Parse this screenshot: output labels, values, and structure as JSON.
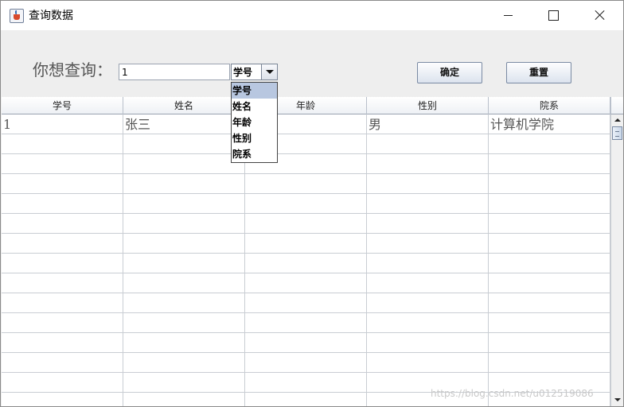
{
  "window": {
    "title": "查询数据"
  },
  "query": {
    "label": "你想查询：",
    "input_value": "1",
    "field_selected": "学号",
    "field_options": [
      "学号",
      "姓名",
      "年龄",
      "性别",
      "院系"
    ],
    "confirm_label": "确定",
    "reset_label": "重置"
  },
  "table": {
    "columns": [
      "学号",
      "姓名",
      "年龄",
      "性别",
      "院系"
    ],
    "rows": [
      [
        "1",
        "张三",
        "",
        "男",
        "计算机学院"
      ],
      [
        "",
        "",
        "",
        "",
        ""
      ],
      [
        "",
        "",
        "",
        "",
        ""
      ],
      [
        "",
        "",
        "",
        "",
        ""
      ],
      [
        "",
        "",
        "",
        "",
        ""
      ],
      [
        "",
        "",
        "",
        "",
        ""
      ],
      [
        "",
        "",
        "",
        "",
        ""
      ],
      [
        "",
        "",
        "",
        "",
        ""
      ],
      [
        "",
        "",
        "",
        "",
        ""
      ],
      [
        "",
        "",
        "",
        "",
        ""
      ],
      [
        "",
        "",
        "",
        "",
        ""
      ],
      [
        "",
        "",
        "",
        "",
        ""
      ],
      [
        "",
        "",
        "",
        "",
        ""
      ],
      [
        "",
        "",
        "",
        "",
        ""
      ],
      [
        "",
        "",
        "",
        "",
        ""
      ]
    ]
  },
  "watermark": "https://blog.csdn.net/u012519086"
}
